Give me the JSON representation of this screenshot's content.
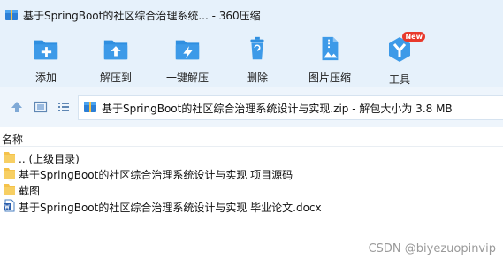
{
  "window": {
    "title": "基于SpringBoot的社区综合治理系统... - 360压缩"
  },
  "toolbar": {
    "items": [
      {
        "label": "添加",
        "icon": "add-icon"
      },
      {
        "label": "解压到",
        "icon": "extract-icon"
      },
      {
        "label": "一键解压",
        "icon": "one-click-extract-icon"
      },
      {
        "label": "删除",
        "icon": "trash-icon"
      },
      {
        "label": "图片压缩",
        "icon": "image-compress-icon"
      },
      {
        "label": "工具",
        "icon": "tools-icon",
        "badge": "New"
      }
    ]
  },
  "address": {
    "text": "基于SpringBoot的社区综合治理系统设计与实现.zip - 解包大小为 3.8 MB"
  },
  "list": {
    "column_name": "名称",
    "rows": [
      {
        "name": ".. (上级目录)",
        "type": "folder"
      },
      {
        "name": "基于SpringBoot的社区综合治理系统设计与实现 项目源码",
        "type": "folder"
      },
      {
        "name": "截图",
        "type": "folder"
      },
      {
        "name": "基于SpringBoot的社区综合治理系统设计与实现 毕业论文.docx",
        "type": "docx"
      }
    ]
  },
  "watermark": "CSDN @biyezuopinvip",
  "colors": {
    "toolbar_bg": "#e6f1fb",
    "icon_blue": "#2f8fe0",
    "folder_yellow": "#f5c24a",
    "badge_red": "#e8392b"
  }
}
